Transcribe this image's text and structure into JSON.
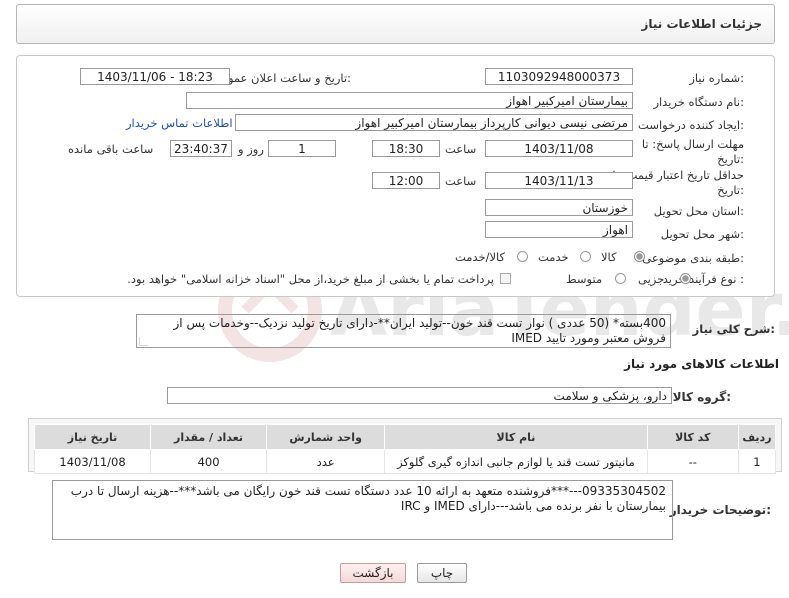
{
  "header": {
    "title": "جزئیات اطلاعات نیاز"
  },
  "form": {
    "need_number_label": "شماره نیاز:",
    "need_number": "1103092948000373",
    "announce_label": "تاریخ و ساعت اعلان عمومی:",
    "announce_value": "1403/11/06 - 18:23",
    "buyer_org_label": "نام دستگاه خریدار:",
    "buyer_org": "بیمارستان امیرکبیر اهواز",
    "creator_label": "ایجاد کننده درخواست:",
    "creator": "مرتضی نیسی دیوانی کارپرداز بیمارستان امیرکبیر اهواز",
    "contact_link": "اطلاعات تماس خریدار",
    "deadline_label_1": "مهلت ارسال پاسخ: تا",
    "deadline_label_2": "تاریخ:",
    "deadline_date": "1403/11/08",
    "time_label": "ساعت",
    "deadline_time": "18:30",
    "days_value": "1",
    "days_label": "روز و",
    "remaining_time": "23:40:37",
    "remaining_label": "ساعت باقی مانده",
    "validity_label_1": "حداقل تاریخ اعتبار قیمت: تا",
    "validity_label_2": "تاریخ:",
    "validity_date": "1403/11/13",
    "validity_time_label": "ساعت",
    "validity_time": "12:00",
    "province_label": "استان محل تحویل:",
    "province": "خوزستان",
    "city_label": "شهر محل تحویل:",
    "city": "اهواز",
    "category_label": "طبقه بندی موضوعی:",
    "category_options": [
      "کالا",
      "خدمت",
      "کالا/خدمت"
    ],
    "category_selected": "کالا",
    "process_label": "نوع فرآیند خرید :",
    "process_options": [
      "جزیی",
      "متوسط"
    ],
    "process_selected": "جزیی",
    "payment_note": "پرداخت تمام یا بخشی از مبلغ خرید،از محل \"اسناد خزانه اسلامی\" خواهد بود."
  },
  "description": {
    "label": "شرح کلی نیاز:",
    "text": "400بسته* (50 عددی ) نوار تست قند خون--تولید ایران**-دارای تاریخ تولید نزدیک--وخدمات پس از فروش معتبر ومورد تایید IMED"
  },
  "goods_info": {
    "title": "اطلاعات کالاهای مورد نیاز",
    "group_label": "گروه کالا:",
    "group_value": "دارو، پزشکی و سلامت",
    "columns": [
      "ردیف",
      "کد کالا",
      "نام کالا",
      "واحد شمارش",
      "تعداد / مقدار",
      "تاریخ نیاز"
    ],
    "rows": [
      [
        "1",
        "--",
        "مانیتور تست قند یا لوازم جانبی اندازه گیری گلوکز",
        "عدد",
        "400",
        "1403/11/08"
      ]
    ]
  },
  "buyer_notes": {
    "label": "توضیحات خریدار:",
    "text": "09335304502---***فروشنده متعهد به ارائه 10 عدد دستگاه تست قند خون رایگان می باشد***--هزینه ارسال تا درب بیمارستان با نفر برنده می باشد---دارای IMED و IRC"
  },
  "buttons": {
    "print": "چاپ",
    "back": "بازگشت"
  },
  "watermark": {
    "text": "AriaTender.net"
  }
}
